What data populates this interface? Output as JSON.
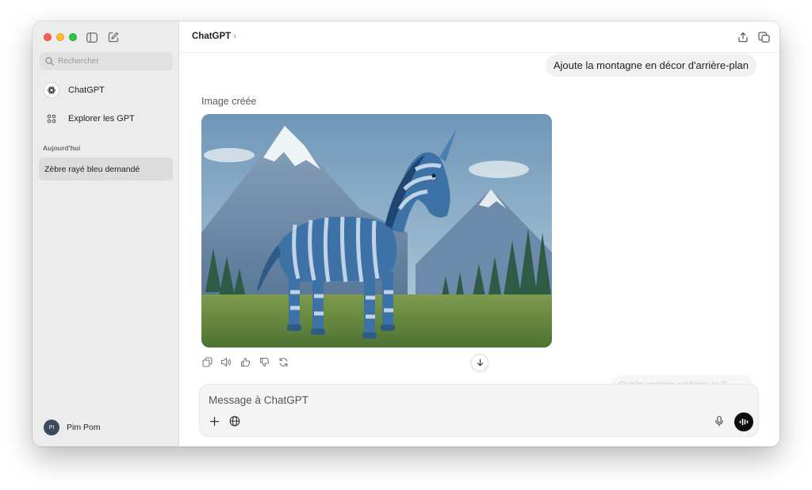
{
  "window": {
    "controls": {
      "close": "#ff5f57",
      "minimize": "#febc2e",
      "zoom": "#28c840"
    }
  },
  "sidebar": {
    "toggle_icon": "sidebar-icon",
    "new_chat_icon": "compose-icon",
    "search": {
      "placeholder": "Rechercher",
      "value": ""
    },
    "nav": [
      {
        "label": "ChatGPT",
        "icon": "openai-logo-icon"
      },
      {
        "label": "Explorer les GPT",
        "icon": "grid-icon"
      }
    ],
    "section_label": "Aujourd'hui",
    "conversations": [
      {
        "title": "Zèbre rayé bleu demandé",
        "active": true
      }
    ],
    "user": {
      "initials": "PI",
      "name": "Pim Pom"
    }
  },
  "header": {
    "title": "ChatGPT",
    "chevron": "›",
    "share_icon": "share-icon",
    "new_window_icon": "new-window-icon"
  },
  "conversation": {
    "user_message": "Ajoute la montagne en décor d'arrière-plan",
    "image_label": "Image créée",
    "image_alt": "blue-striped-unicorn-zebra-with-mountains",
    "action_icons": [
      "copy-icon",
      "speaker-icon",
      "thumbs-up-icon",
      "thumbs-down-icon",
      "regenerate-icon"
    ],
    "faded_text": "Quelle version préfères-tu ?"
  },
  "composer": {
    "placeholder": "Message à ChatGPT",
    "value": "",
    "add_icon": "plus-icon",
    "web_icon": "globe-icon",
    "mic_icon": "microphone-icon",
    "voice_icon": "voice-mode-icon"
  },
  "colors": {
    "sidebar_bg": "#ececec",
    "active_item_bg": "#dcdcdc",
    "bubble_bg": "#f1f1f1",
    "composer_bg": "#f4f4f4",
    "voice_button": "#0d0d0d"
  }
}
